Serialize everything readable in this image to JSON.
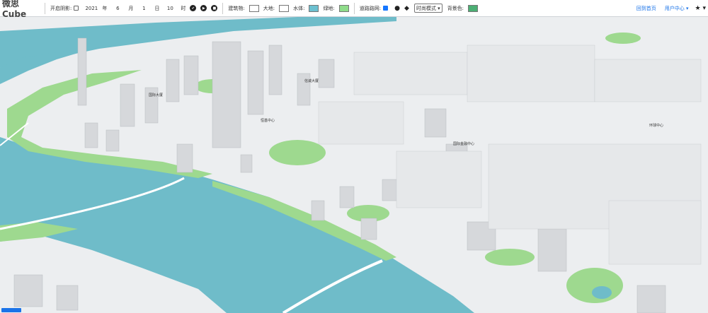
{
  "app": {
    "logo": "微思Cube"
  },
  "toolbar": {
    "shadow_label": "开启阴影:",
    "year": "2021",
    "year_unit": "年",
    "month": "6",
    "month_unit": "月",
    "day": "1",
    "day_unit": "日",
    "hour": "10",
    "hour_unit": "时",
    "building_label": "建筑物:",
    "land_label": "大地:",
    "water_label": "水体:",
    "green_label": "绿地:",
    "road_label": "道路路网:",
    "mode_select": "时尚模式",
    "background_label": "背景色:",
    "home_link": "回到首页",
    "user_center": "用户中心",
    "colors": {
      "building": "#ffffff",
      "land": "#ffffff",
      "water": "#6cc0d0",
      "green": "#8fdc8a",
      "background": "#4caf74"
    }
  },
  "map": {
    "labels": [
      "信诚大厦",
      "恒基中心",
      "国际金融中心",
      "环球中心",
      "国际大厦"
    ],
    "colors": {
      "water": "#6fbcc9",
      "land": "#eceef0",
      "green": "#9ed98f",
      "building": "#d6d8db"
    }
  }
}
